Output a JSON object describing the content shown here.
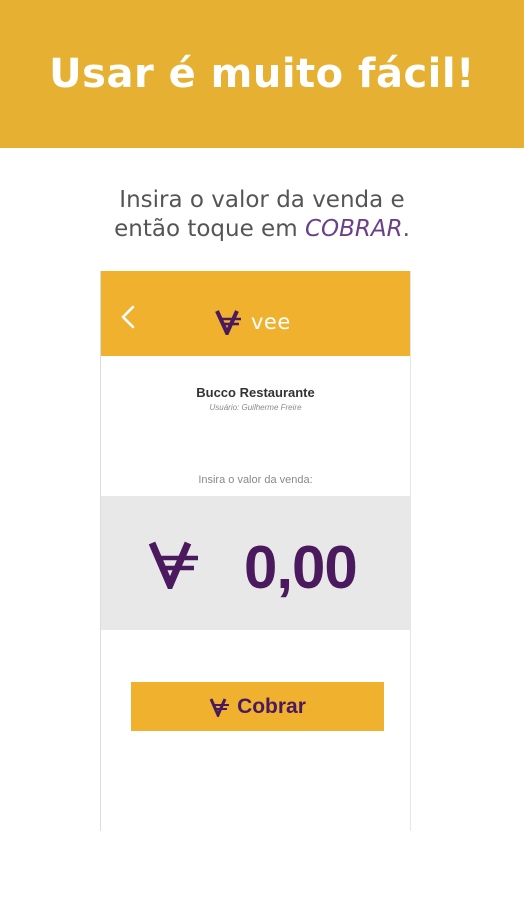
{
  "banner": {
    "title": "Usar é muito fácil!"
  },
  "instruction": {
    "line1": "Insira o valor da venda e",
    "line2_before": "então toque em ",
    "line2_accent": "COBRAR",
    "line2_after": "."
  },
  "app_bar": {
    "back_icon": "chevron-left-icon",
    "logo_icon": "vee-currency-icon",
    "logo_text": "vee"
  },
  "merchant": {
    "name": "Bucco Restaurante",
    "user": "Usuário: Guilherme Freire"
  },
  "sale": {
    "label": "Insira o valor da venda:",
    "currency_icon": "vee-currency-icon",
    "amount": "0,00"
  },
  "charge_button": {
    "icon": "vee-currency-icon",
    "label": "Cobrar"
  },
  "colors": {
    "banner": "#e6b132",
    "app_bar": "#f0b12e",
    "brand_purple": "#4b1a5e",
    "accent_purple": "#6a3f8c",
    "amount_background": "#e8e8e8"
  }
}
